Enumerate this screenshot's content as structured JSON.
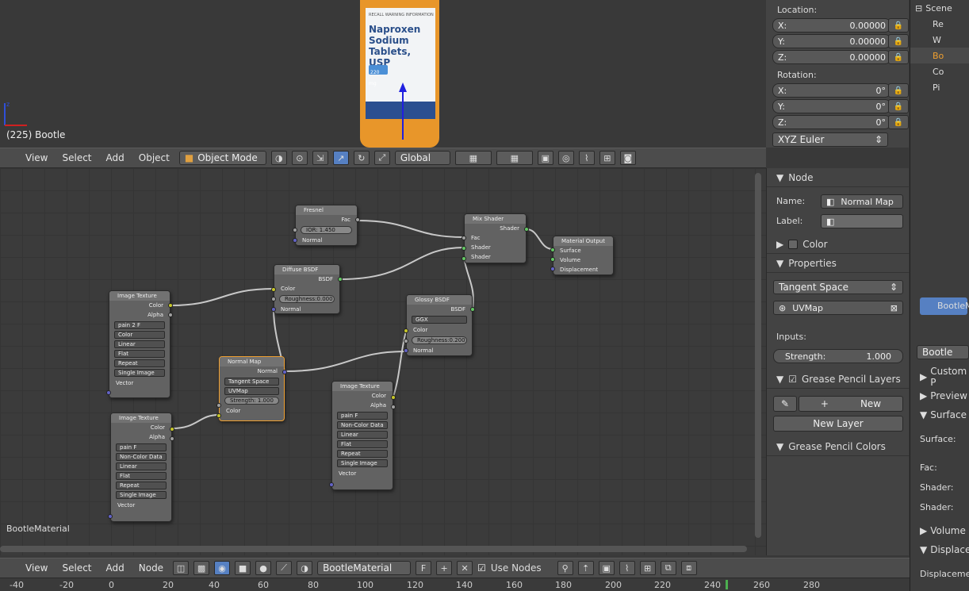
{
  "viewport": {
    "caption": "(225) Bootle"
  },
  "bottle_label": {
    "brand": "RECALL WARNING INFORMATION",
    "name": "Naproxen Sodium Tablets, USP",
    "dose": "220 mg"
  },
  "props": {
    "location_label": "Location:",
    "loc": [
      {
        "axis": "X:",
        "value": "0.00000"
      },
      {
        "axis": "Y:",
        "value": "0.00000"
      },
      {
        "axis": "Z:",
        "value": "0.00000"
      }
    ],
    "rotation_label": "Rotation:",
    "rot": [
      {
        "axis": "X:",
        "value": "0°"
      },
      {
        "axis": "Y:",
        "value": "0°"
      },
      {
        "axis": "Z:",
        "value": "0°"
      }
    ],
    "rot_mode": "XYZ Euler"
  },
  "outliner": {
    "items": [
      "Scene",
      "Re",
      "W",
      "Bo",
      "Co",
      "Pi"
    ]
  },
  "header3d": {
    "view": "View",
    "select": "Select",
    "add": "Add",
    "object": "Object",
    "mode": "Object Mode",
    "orientation": "Global"
  },
  "nodes": {
    "fresnel": {
      "title": "Fresnel",
      "out": "Fac",
      "ior": "IOR:     1.450",
      "normal": "Normal"
    },
    "mix": {
      "title": "Mix Shader",
      "out": "Shader",
      "fac": "Fac",
      "s1": "Shader",
      "s2": "Shader"
    },
    "output": {
      "title": "Material Output",
      "surface": "Surface",
      "volume": "Volume",
      "disp": "Displacement"
    },
    "diffuse": {
      "title": "Diffuse BSDF",
      "out": "BSDF",
      "color": "Color",
      "rough": "Roughness:0.000",
      "normal": "Normal"
    },
    "glossy": {
      "title": "Glossy BSDF",
      "out": "BSDF",
      "dist": "GGX",
      "color": "Color",
      "rough": "Roughness:0.200",
      "normal": "Normal"
    },
    "img1": {
      "title": "Image Texture",
      "color": "Color",
      "alpha": "Alpha",
      "img": "pain 2 F",
      "cs": "Color",
      "interp": "Linear",
      "proj": "Flat",
      "ext": "Repeat",
      "src": "Single Image",
      "vec": "Vector"
    },
    "normalmap": {
      "title": "Normal Map",
      "out": "Normal",
      "space": "Tangent Space",
      "uv": "UVMap",
      "strength": "Strength:    1.000",
      "color": "Color"
    },
    "img2": {
      "title": "Image Texture",
      "color": "Color",
      "alpha": "Alpha",
      "img": "pain F",
      "cs": "Non-Color Data",
      "interp": "Linear",
      "proj": "Flat",
      "ext": "Repeat",
      "src": "Single Image",
      "vec": "Vector"
    },
    "img3": {
      "title": "Image Texture",
      "color": "Color",
      "alpha": "Alpha",
      "img": "pain F",
      "cs": "Non-Color Data",
      "interp": "Linear",
      "proj": "Flat",
      "ext": "Repeat",
      "src": "Single Image",
      "vec": "Vector"
    }
  },
  "node_caption": "BootleMaterial",
  "npanel": {
    "node_title": "Node",
    "name_label": "Name:",
    "name_value": "Normal Map",
    "label_label": "Label:",
    "color": "Color",
    "properties": "Properties",
    "space": "Tangent Space",
    "uvmap": "UVMap",
    "inputs": "Inputs:",
    "strength_label": "Strength:",
    "strength_value": "1.000",
    "gp_layers": "Grease Pencil Layers",
    "new": "New",
    "new_layer": "New Layer",
    "gp_colors": "Grease Pencil Colors"
  },
  "farright": {
    "mat": "BootleM",
    "mat2": "Bootle",
    "custom": "Custom P",
    "preview": "Preview",
    "surface": "Surface",
    "surface_lbl": "Surface:",
    "fac": "Fac:",
    "shader1": "Shader:",
    "shader2": "Shader:",
    "volume": "Volume",
    "displace": "Displace",
    "displace_lbl": "Displaceme"
  },
  "nodeheader": {
    "view": "View",
    "select": "Select",
    "add": "Add",
    "node": "Node",
    "material": "BootleMaterial",
    "f": "F",
    "use_nodes": "Use Nodes"
  },
  "ruler": [
    "-40",
    "-20",
    "0",
    "20",
    "40",
    "60",
    "80",
    "100",
    "120",
    "140",
    "160",
    "180",
    "200",
    "220",
    "240",
    "260",
    "280"
  ]
}
